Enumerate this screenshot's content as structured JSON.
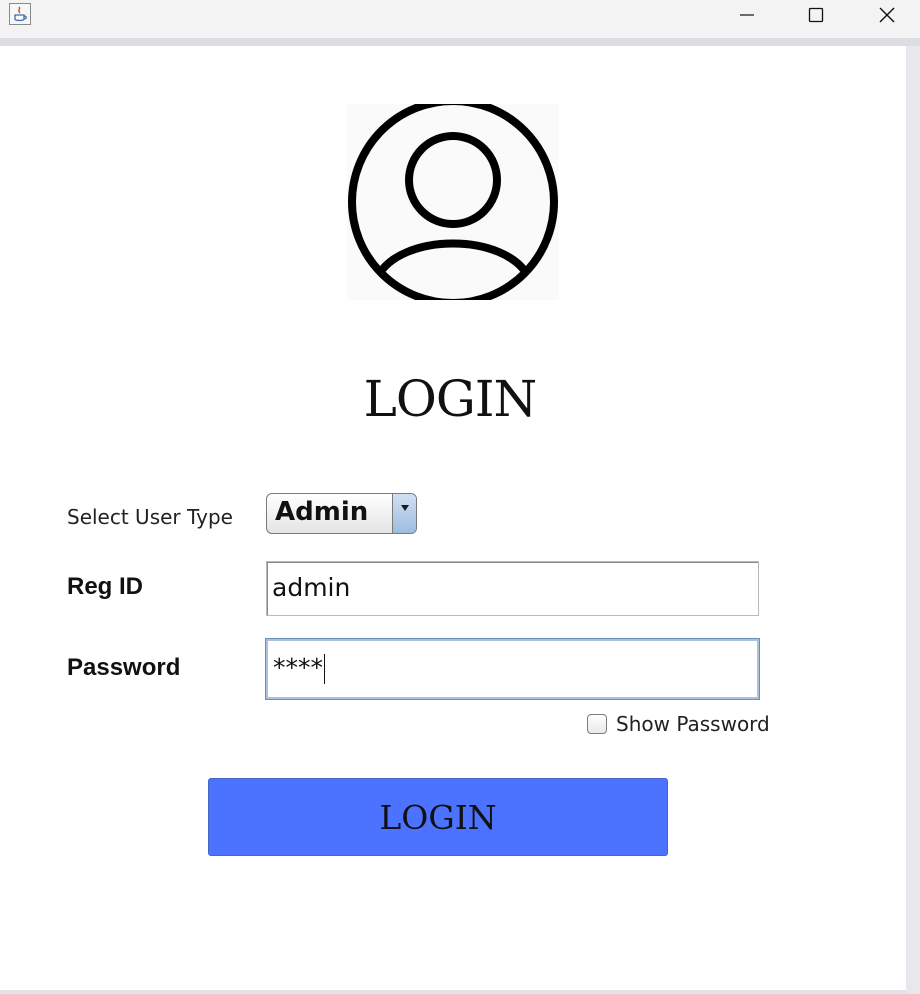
{
  "window": {
    "minimize_icon": "minimize-icon",
    "maximize_icon": "maximize-icon",
    "close_icon": "close-icon",
    "app_icon": "java-app-icon"
  },
  "page": {
    "title": "LOGIN",
    "avatar_icon": "user-avatar-icon"
  },
  "form": {
    "user_type_label": "Select User Type",
    "user_type_value": "Admin",
    "reg_id_label": "Reg ID",
    "reg_id_value": "admin",
    "password_label": "Password",
    "password_value": "****",
    "show_password_label": "Show Password",
    "show_password_checked": false,
    "login_button": "LOGIN"
  },
  "colors": {
    "login_button_bg": "#4c73ff",
    "background": "#ffffff"
  }
}
